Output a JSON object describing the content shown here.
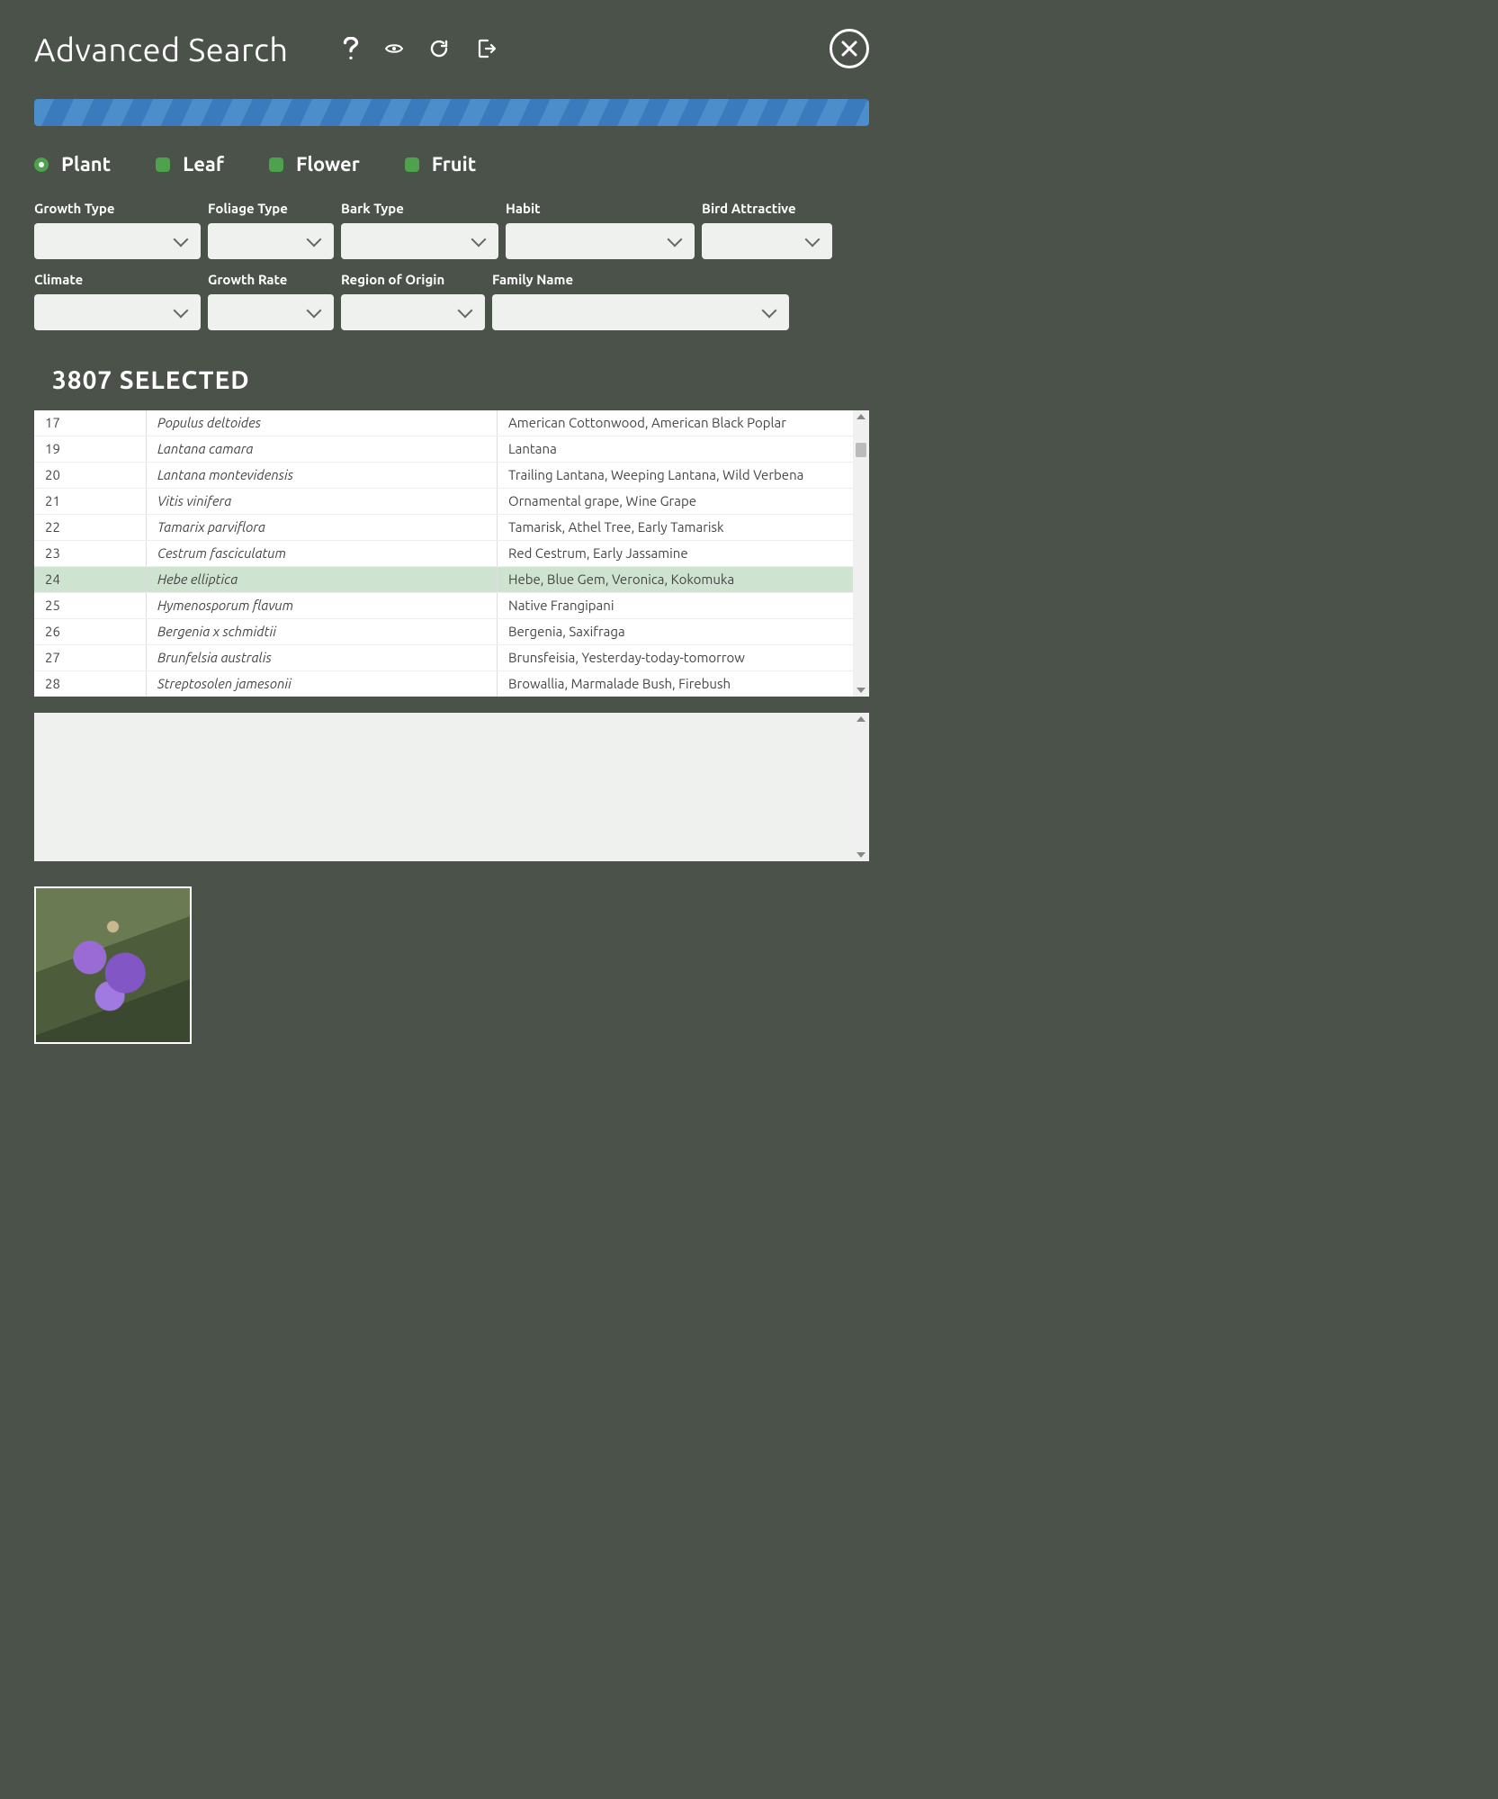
{
  "header": {
    "title": "Advanced Search"
  },
  "categories": [
    {
      "label": "Plant",
      "selected": true
    },
    {
      "label": "Leaf",
      "selected": false
    },
    {
      "label": "Flower",
      "selected": false
    },
    {
      "label": "Fruit",
      "selected": false
    }
  ],
  "filters_row1": [
    {
      "label": "Growth Type"
    },
    {
      "label": "Foliage Type"
    },
    {
      "label": "Bark Type"
    },
    {
      "label": "Habit"
    },
    {
      "label": "Bird Attractive"
    }
  ],
  "filters_row2": [
    {
      "label": "Climate"
    },
    {
      "label": "Growth Rate"
    },
    {
      "label": "Region of Origin"
    },
    {
      "label": "Family Name"
    }
  ],
  "selected_count_text": "3807 SELECTED",
  "results": [
    {
      "id": "17",
      "latin": "Populus deltoides",
      "common": "American Cottonwood, American Black Poplar",
      "highlight": false
    },
    {
      "id": "19",
      "latin": "Lantana camara",
      "common": "Lantana",
      "highlight": false
    },
    {
      "id": "20",
      "latin": "Lantana montevidensis",
      "common": "Trailing Lantana, Weeping Lantana, Wild Verbena",
      "highlight": false
    },
    {
      "id": "21",
      "latin": "Vitis vinifera",
      "common": "Ornamental grape, Wine Grape",
      "highlight": false
    },
    {
      "id": "22",
      "latin": "Tamarix parviflora",
      "common": "Tamarisk, Athel Tree, Early Tamarisk",
      "highlight": false
    },
    {
      "id": "23",
      "latin": "Cestrum fasciculatum",
      "common": "Red Cestrum, Early Jassamine",
      "highlight": false
    },
    {
      "id": "24",
      "latin": "Hebe elliptica",
      "common": "Hebe, Blue Gem, Veronica, Kokomuka",
      "highlight": true
    },
    {
      "id": "25",
      "latin": "Hymenosporum flavum",
      "common": "Native Frangipani",
      "highlight": false
    },
    {
      "id": "26",
      "latin": "Bergenia x schmidtii",
      "common": "Bergenia, Saxifraga",
      "highlight": false
    },
    {
      "id": "27",
      "latin": "Brunfelsia australis",
      "common": "Brunsfeisia, Yesterday-today-tomorrow",
      "highlight": false
    },
    {
      "id": "28",
      "latin": "Streptosolen jamesonii",
      "common": "Browallia, Marmalade Bush, Firebush",
      "highlight": false
    }
  ],
  "thumbnail": {
    "alt": "Hebe elliptica purple flower cluster"
  }
}
